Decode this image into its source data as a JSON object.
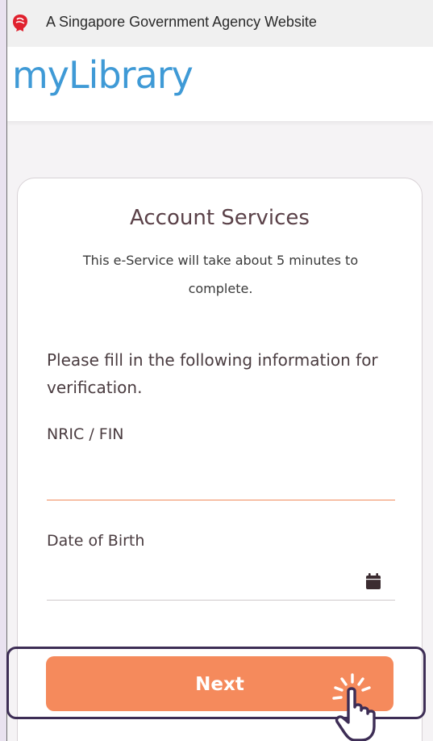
{
  "gov_bar": {
    "text": "A Singapore Government Agency Website",
    "icon": "lion-head-icon"
  },
  "header": {
    "logo": "myLibrary"
  },
  "card": {
    "title": "Account Services",
    "subtitle": "This e-Service will take about 5 minutes to complete.",
    "instructions": "Please fill in the following information for verification.",
    "fields": {
      "nric_label": "NRIC / FIN",
      "nric_value": "",
      "dob_label": "Date of Birth",
      "dob_value": ""
    },
    "next_label": "Next"
  },
  "colors": {
    "accent": "#f58a5c",
    "logo_blue": "#3f9ad6",
    "title_text": "#5a4148",
    "highlight": "#3d2d55"
  },
  "icons": {
    "calendar": "calendar-icon",
    "pointer": "hand-pointer-icon"
  }
}
